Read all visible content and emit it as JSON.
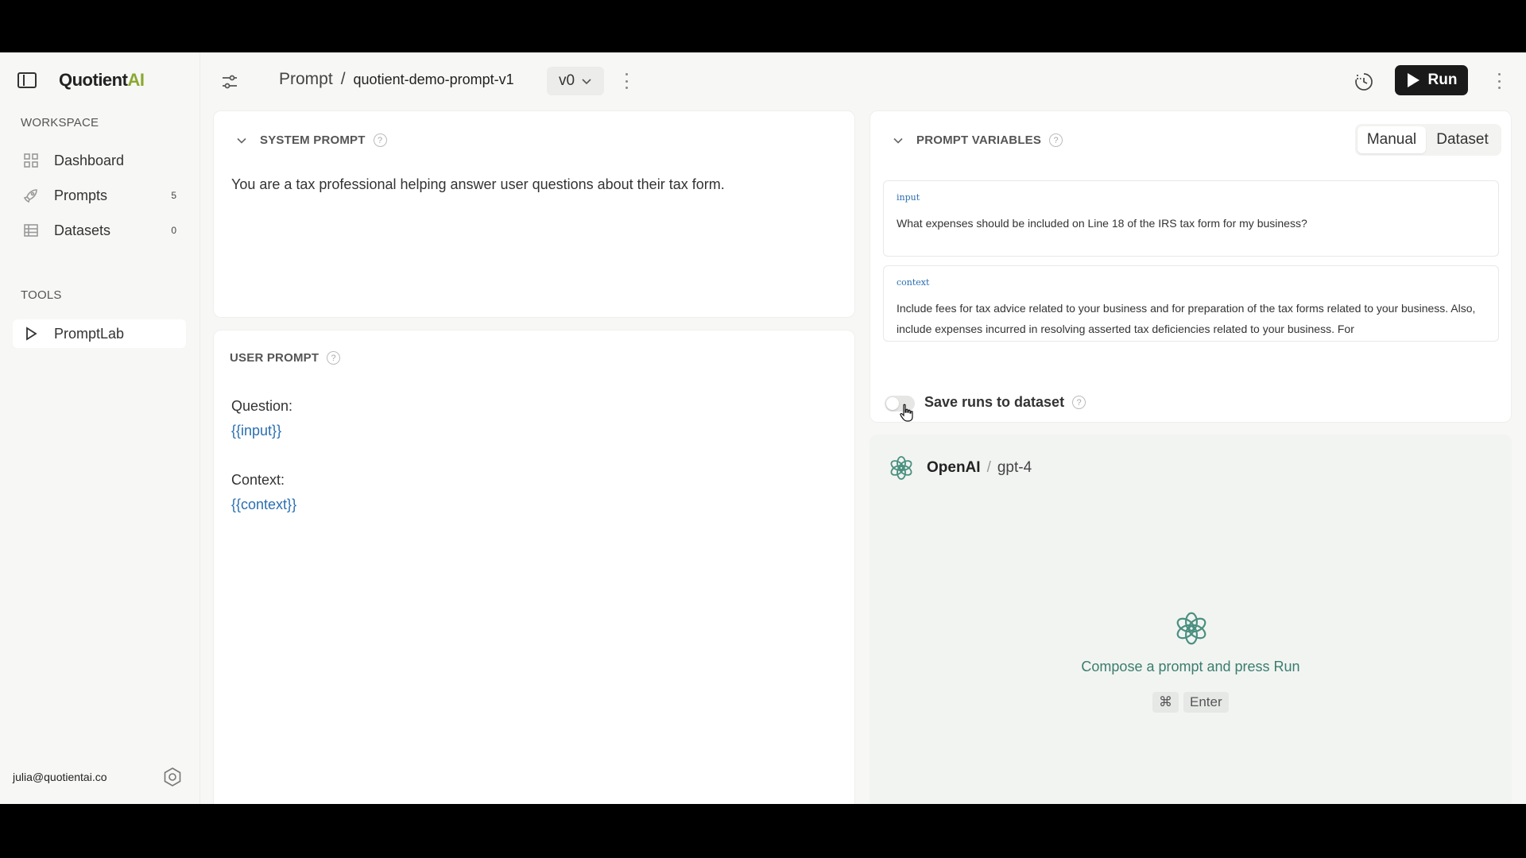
{
  "app": {
    "brand_main": "Quotient",
    "brand_ai": "AI"
  },
  "sidebar": {
    "workspace_label": "WORKSPACE",
    "tools_label": "TOOLS",
    "items": [
      {
        "label": "Dashboard",
        "count": "",
        "icon": "grid-icon"
      },
      {
        "label": "Prompts",
        "count": "5",
        "icon": "rocket-icon"
      },
      {
        "label": "Datasets",
        "count": "0",
        "icon": "table-icon"
      }
    ],
    "tools": [
      {
        "label": "PromptLab",
        "icon": "play-icon"
      }
    ],
    "user_email": "julia@quotientai.co"
  },
  "header": {
    "crumb_root": "Prompt",
    "crumb_sep": "/",
    "prompt_name": "quotient-demo-prompt-v1",
    "version": "v0",
    "run_label": "Run"
  },
  "system_prompt": {
    "title": "SYSTEM PROMPT",
    "text": "You are a tax professional helping answer user questions about their tax form."
  },
  "user_prompt": {
    "title": "USER PROMPT",
    "line1": "Question:",
    "line2": "{{input}}",
    "line3": "Context:",
    "line4": "{{context}}"
  },
  "prompt_variables": {
    "title": "PROMPT VARIABLES",
    "mode_manual": "Manual",
    "mode_dataset": "Dataset",
    "vars": [
      {
        "name": "input",
        "value": "What expenses should be included on Line 18 of the IRS tax form for my business?"
      },
      {
        "name": "context",
        "value": "Include fees for tax advice related to your business and for preparation of the tax forms related to your business. Also, include expenses incurred in resolving asserted tax deficiencies related to your business. For"
      }
    ],
    "save_runs_label": "Save runs to dataset",
    "save_runs_enabled": false
  },
  "output": {
    "provider": "OpenAI",
    "slash": "/",
    "model": "gpt-4",
    "empty_text": "Compose a prompt and press Run",
    "kbd_cmd": "⌘",
    "kbd_enter": "Enter"
  },
  "colors": {
    "accent_ai": "#8ba832",
    "link": "#2a6fb0",
    "openai_green": "#3a7d6d"
  }
}
